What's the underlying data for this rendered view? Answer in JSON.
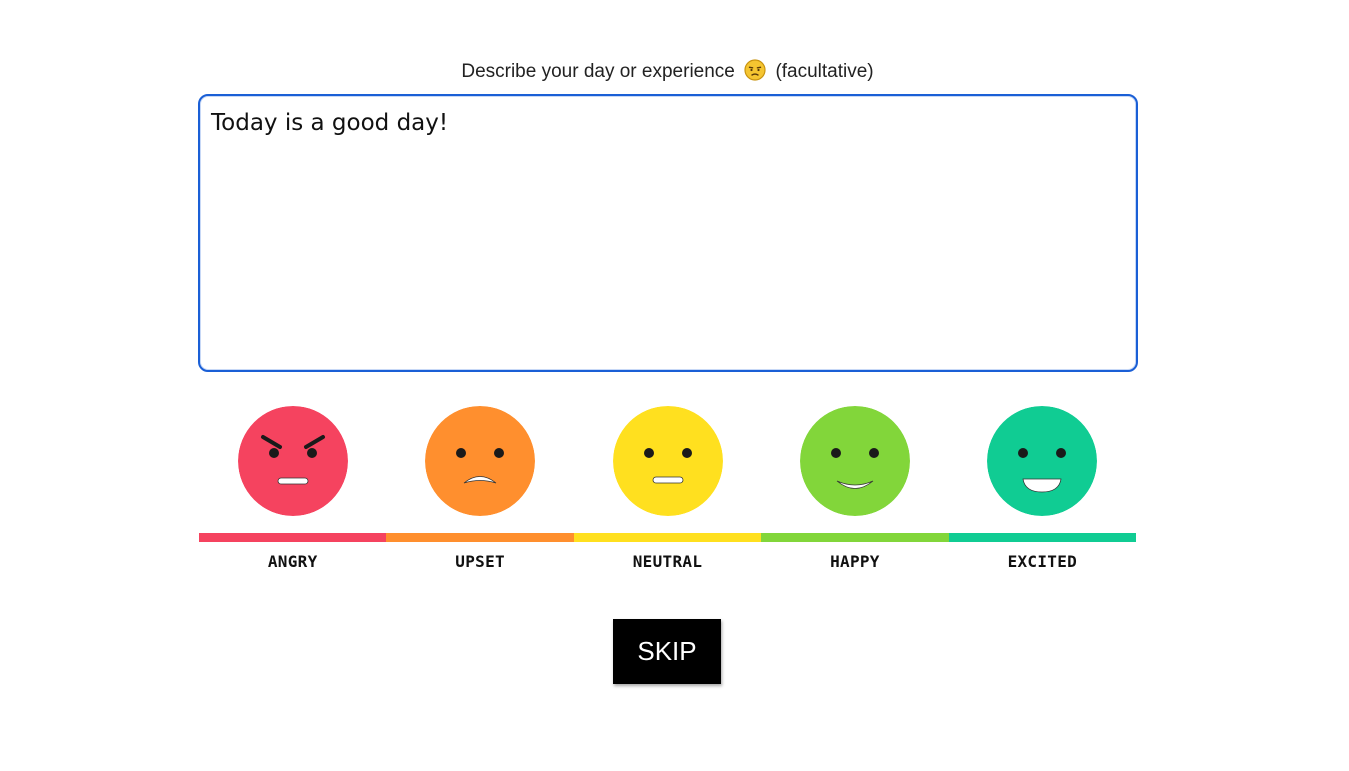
{
  "prompt": {
    "text_before": "Describe your day or experience",
    "emoji_icon": "pensive-face-icon",
    "text_after": "(facultative)"
  },
  "textarea": {
    "value": "Today is a good day!"
  },
  "moods": [
    {
      "label": "ANGRY",
      "color": "#f5435f",
      "icon": "angry-face-icon"
    },
    {
      "label": "UPSET",
      "color": "#ff8f2e",
      "icon": "upset-face-icon"
    },
    {
      "label": "NEUTRAL",
      "color": "#ffe01f",
      "icon": "neutral-face-icon"
    },
    {
      "label": "HAPPY",
      "color": "#82d63a",
      "icon": "happy-face-icon"
    },
    {
      "label": "EXCITED",
      "color": "#10cc93",
      "icon": "excited-face-icon"
    }
  ],
  "skip_button": {
    "label": "SKIP"
  }
}
